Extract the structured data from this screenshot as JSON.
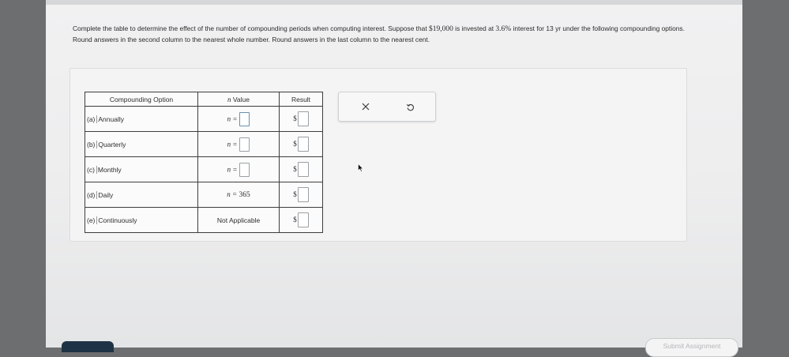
{
  "question": {
    "part1": "Complete the table to determine the effect of the number of compounding periods when computing interest. Suppose that ",
    "principal": "$19,000",
    "part2": " is invested at ",
    "rate": "3.6%",
    "part3": " interest for 13 yr under the following compounding options. Round answers in the second column to the nearest whole number. Round answers in the last column to the nearest cent."
  },
  "table": {
    "headers": {
      "option": "Compounding Option",
      "n": "n Value",
      "result": "Result"
    },
    "rows": [
      {
        "letter": "(a)",
        "label": "Annually",
        "n_prefix": "n =",
        "n_value": "",
        "dollar": "$"
      },
      {
        "letter": "(b)",
        "label": "Quarterly",
        "n_prefix": "n =",
        "n_value": "",
        "dollar": "$"
      },
      {
        "letter": "(c)",
        "label": "Monthly",
        "n_prefix": "n =",
        "n_value": "",
        "dollar": "$"
      },
      {
        "letter": "(d)",
        "label": "Daily",
        "n_prefix": "n =",
        "n_value": "365",
        "dollar": "$"
      },
      {
        "letter": "(e)",
        "label": "Continuously",
        "n_text": "Not Applicable",
        "dollar": "$"
      }
    ]
  },
  "toolbar": {
    "clear": "×",
    "undo": "↺"
  },
  "footer": {
    "submit_label": "Submit Assignment"
  }
}
